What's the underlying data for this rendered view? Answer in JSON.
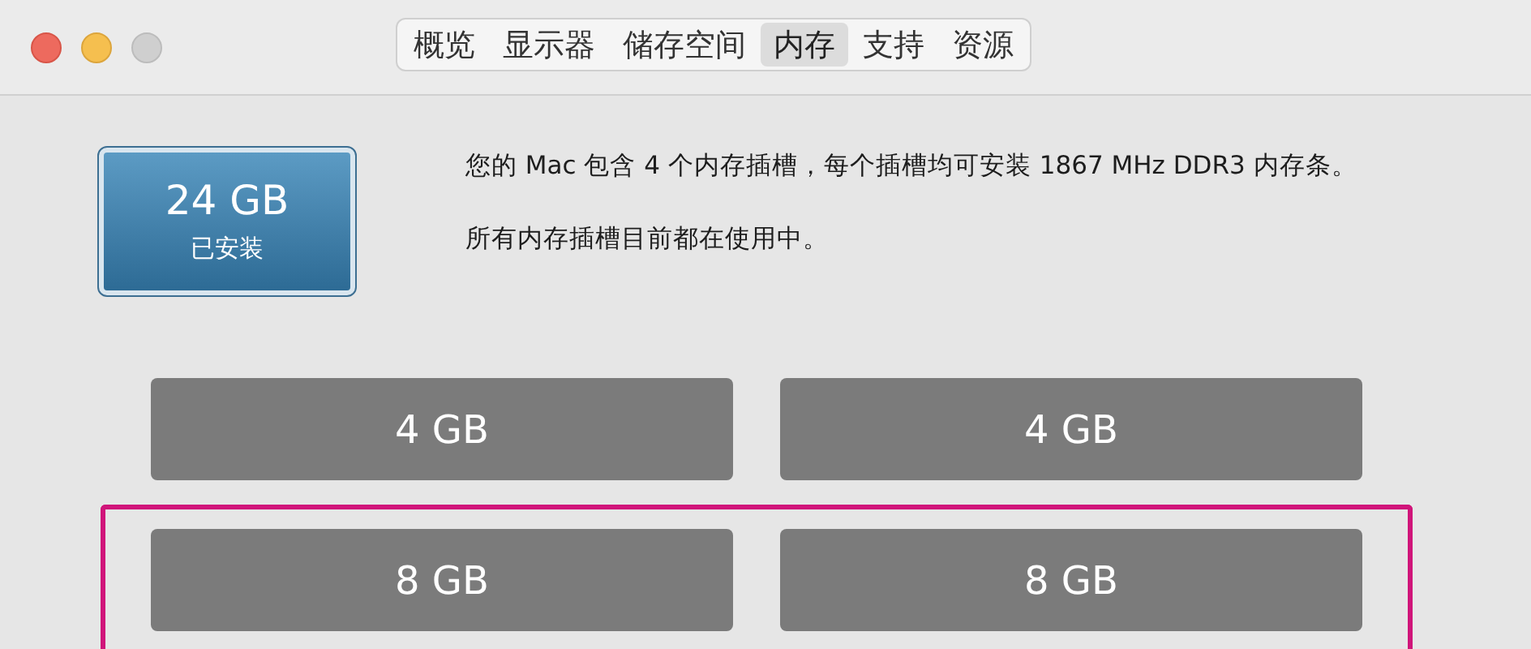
{
  "tabs": [
    {
      "label": "概览",
      "selected": false
    },
    {
      "label": "显示器",
      "selected": false
    },
    {
      "label": "储存空间",
      "selected": false
    },
    {
      "label": "内存",
      "selected": true
    },
    {
      "label": "支持",
      "selected": false
    },
    {
      "label": "资源",
      "selected": false
    }
  ],
  "memory": {
    "size": "24 GB",
    "caption": "已安装"
  },
  "info": [
    "您的 Mac 包含 4 个内存插槽，每个插槽均可安装 1867 MHz DDR3 内存条。",
    "所有内存插槽目前都在使用中。"
  ],
  "slots": [
    {
      "label": "4 GB"
    },
    {
      "label": "4 GB"
    },
    {
      "label": "8 GB"
    },
    {
      "label": "8 GB"
    }
  ]
}
